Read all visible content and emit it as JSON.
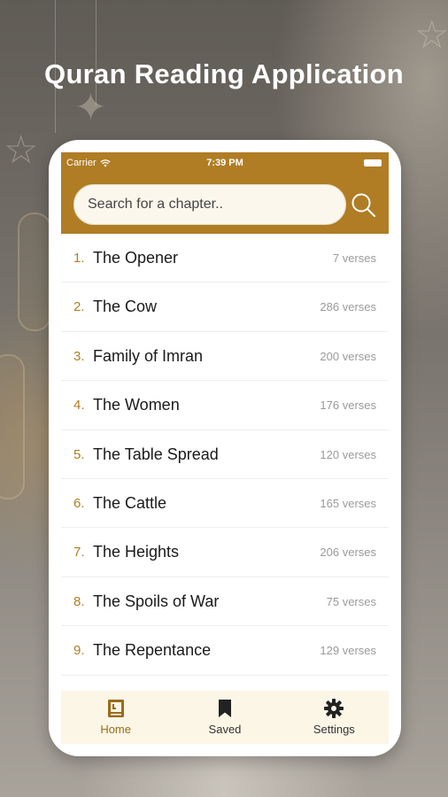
{
  "promo": {
    "headline": "Quran Reading Application"
  },
  "status_bar": {
    "carrier": "Carrier",
    "time": "7:39 PM"
  },
  "search": {
    "placeholder": "Search for a chapter..",
    "icon": "search-icon"
  },
  "chapters": [
    {
      "number": "1.",
      "title": "The Opener",
      "verses": "7 verses"
    },
    {
      "number": "2.",
      "title": "The Cow",
      "verses": "286 verses"
    },
    {
      "number": "3.",
      "title": "Family of Imran",
      "verses": "200 verses"
    },
    {
      "number": "4.",
      "title": "The Women",
      "verses": "176 verses"
    },
    {
      "number": "5.",
      "title": "The Table Spread",
      "verses": "120 verses"
    },
    {
      "number": "6.",
      "title": "The Cattle",
      "verses": "165 verses"
    },
    {
      "number": "7.",
      "title": "The Heights",
      "verses": "206 verses"
    },
    {
      "number": "8.",
      "title": "The Spoils of War",
      "verses": "75 verses"
    },
    {
      "number": "9.",
      "title": "The Repentance",
      "verses": "129 verses"
    }
  ],
  "tabs": [
    {
      "label": "Home",
      "icon": "book-icon",
      "active": true
    },
    {
      "label": "Saved",
      "icon": "bookmark-icon",
      "active": false
    },
    {
      "label": "Settings",
      "icon": "gear-icon",
      "active": false
    }
  ],
  "colors": {
    "accent": "#b07d25",
    "tab_active": "#9a6b1b",
    "tabbar_bg": "#fbf6e6",
    "search_bg": "#fbf7ec"
  }
}
